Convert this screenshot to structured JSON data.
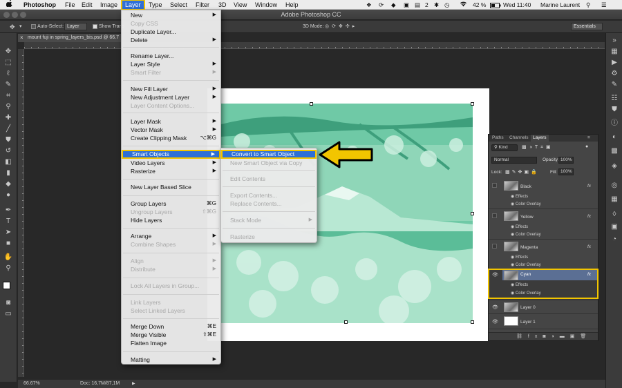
{
  "menubar": {
    "apple": "",
    "app": "Photoshop",
    "items": [
      "File",
      "Edit",
      "Image",
      "Layer",
      "Type",
      "Select",
      "Filter",
      "3D",
      "View",
      "Window",
      "Help"
    ],
    "status": {
      "badge": "2",
      "battery": "42 %",
      "clock": "Wed 11:40",
      "user": "Marine Laurent"
    }
  },
  "window": {
    "title": "Adobe Photoshop CC"
  },
  "options": {
    "auto_select": "Auto-Select:",
    "auto_select_value": "Layer",
    "show_transform": "Show Trans",
    "mode_3d": "3D Mode:",
    "workspace": "Essentials"
  },
  "document": {
    "tab": "mount fuji in spring_layers_bis.psd @ 66.7",
    "zoom": "66.67%",
    "doc_size": "Doc: 16,7M/87,1M"
  },
  "layer_menu": {
    "items": [
      {
        "label": "New",
        "sub": true,
        "enabled": true
      },
      {
        "label": "Copy CSS",
        "enabled": false
      },
      {
        "label": "Duplicate Layer...",
        "enabled": true
      },
      {
        "label": "Delete",
        "sub": true,
        "enabled": true
      },
      {
        "label": "Rename Layer...",
        "enabled": true
      },
      {
        "label": "Layer Style",
        "sub": true,
        "enabled": true
      },
      {
        "label": "Smart Filter",
        "sub": true,
        "enabled": false
      },
      {
        "label": "New Fill Layer",
        "sub": true,
        "enabled": true
      },
      {
        "label": "New Adjustment Layer",
        "sub": true,
        "enabled": true
      },
      {
        "label": "Layer Content Options...",
        "enabled": false
      },
      {
        "label": "Layer Mask",
        "sub": true,
        "enabled": true
      },
      {
        "label": "Vector Mask",
        "sub": true,
        "enabled": true
      },
      {
        "label": "Create Clipping Mask",
        "shortcut": "⌥⌘G",
        "enabled": true
      },
      {
        "label": "Smart Objects",
        "sub": true,
        "enabled": true,
        "selected": true
      },
      {
        "label": "Video Layers",
        "sub": true,
        "enabled": true
      },
      {
        "label": "Rasterize",
        "sub": true,
        "enabled": true
      },
      {
        "label": "New Layer Based Slice",
        "enabled": true
      },
      {
        "label": "Group Layers",
        "shortcut": "⌘G",
        "enabled": true
      },
      {
        "label": "Ungroup Layers",
        "shortcut": "⇧⌘G",
        "enabled": false
      },
      {
        "label": "Hide Layers",
        "enabled": true
      },
      {
        "label": "Arrange",
        "sub": true,
        "enabled": true
      },
      {
        "label": "Combine Shapes",
        "sub": true,
        "enabled": false
      },
      {
        "label": "Align",
        "sub": true,
        "enabled": false
      },
      {
        "label": "Distribute",
        "sub": true,
        "enabled": false
      },
      {
        "label": "Lock All Layers in Group...",
        "enabled": false
      },
      {
        "label": "Link Layers",
        "enabled": false
      },
      {
        "label": "Select Linked Layers",
        "enabled": false
      },
      {
        "label": "Merge Down",
        "shortcut": "⌘E",
        "enabled": true
      },
      {
        "label": "Merge Visible",
        "shortcut": "⇧⌘E",
        "enabled": true
      },
      {
        "label": "Flatten Image",
        "enabled": true
      },
      {
        "label": "Matting",
        "sub": true,
        "enabled": true
      }
    ]
  },
  "smart_objects_menu": {
    "items": [
      {
        "label": "Convert to Smart Object",
        "enabled": true,
        "selected": true
      },
      {
        "label": "New Smart Object via Copy",
        "enabled": false
      },
      {
        "label": "Edit Contents",
        "enabled": false
      },
      {
        "label": "Export Contents...",
        "enabled": false
      },
      {
        "label": "Replace Contents...",
        "enabled": false
      },
      {
        "label": "Stack Mode",
        "sub": true,
        "enabled": false
      },
      {
        "label": "Rasterize",
        "enabled": false
      }
    ]
  },
  "layers_panel": {
    "tabs": [
      "Paths",
      "Channels",
      "Layers"
    ],
    "filter": "Kind",
    "blend_mode": "Normal",
    "opacity_label": "Opacity:",
    "opacity": "100%",
    "lock_label": "Lock:",
    "fill_label": "Fill:",
    "fill": "100%",
    "effects_label": "Effects",
    "effect_name": "Color Overlay",
    "layers": [
      {
        "name": "Black",
        "visible": false,
        "has_fx": true
      },
      {
        "name": "Yellow",
        "visible": false,
        "has_fx": true
      },
      {
        "name": "Magenta",
        "visible": false,
        "has_fx": true
      },
      {
        "name": "Cyan",
        "visible": true,
        "has_fx": true,
        "selected": true
      },
      {
        "name": "Layer 0",
        "visible": true,
        "has_fx": false
      },
      {
        "name": "Layer 1",
        "visible": true,
        "has_fx": false
      }
    ]
  },
  "colors": {
    "accent": "#2e6fd6",
    "highlight": "#f2c500",
    "image_tint": "#6fc9a6"
  }
}
